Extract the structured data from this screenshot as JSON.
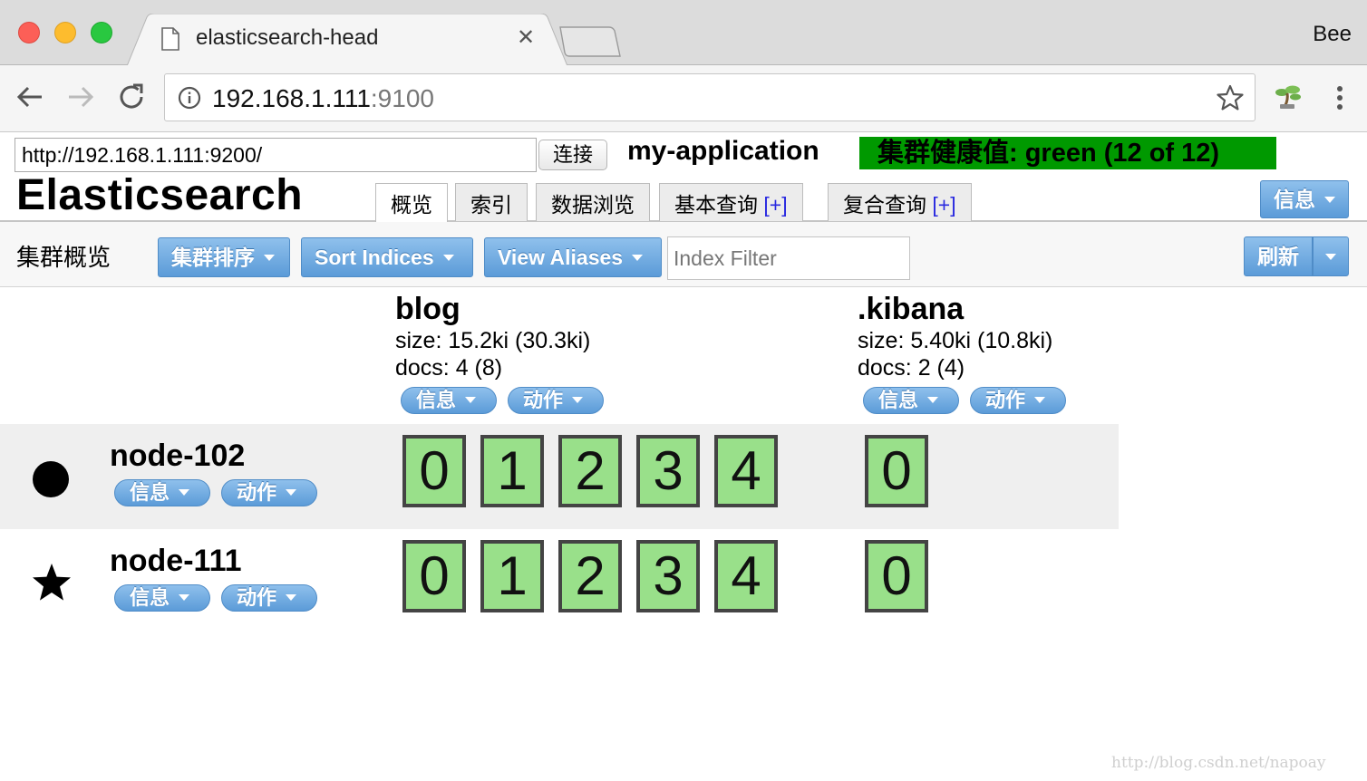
{
  "browser": {
    "tab_title": "elasticsearch-head",
    "profile_name": "Bee",
    "url_host": "192.168.1.111",
    "url_port": ":9100"
  },
  "header": {
    "connection_url": "http://192.168.1.111:9200/",
    "connect_label": "连接",
    "cluster_name": "my-application",
    "health_text": "集群健康值: green (12 of 12)",
    "health_color": "#009900",
    "brand": "Elasticsearch",
    "info_label": "信息",
    "tabs": [
      {
        "label": "概览",
        "plus": ""
      },
      {
        "label": "索引",
        "plus": ""
      },
      {
        "label": "数据浏览",
        "plus": ""
      },
      {
        "label": "基本查询 ",
        "plus": "[+]"
      },
      {
        "label": "复合查询 ",
        "plus": "[+]"
      }
    ]
  },
  "overview": {
    "title": "集群概览",
    "sort_cluster_label": "集群排序",
    "sort_indices_label": "Sort Indices",
    "view_aliases_label": "View Aliases",
    "index_filter_placeholder": "Index Filter",
    "refresh_label": "刷新"
  },
  "indices": [
    {
      "name": "blog",
      "size": "size: 15.2ki (30.3ki)",
      "docs": "docs: 4 (8)",
      "info_label": "信息",
      "action_label": "动作",
      "shards": [
        "0",
        "1",
        "2",
        "3",
        "4"
      ]
    },
    {
      "name": ".kibana",
      "size": "size: 5.40ki (10.8ki)",
      "docs": "docs: 2 (4)",
      "info_label": "信息",
      "action_label": "动作",
      "shards": [
        "0"
      ]
    }
  ],
  "nodes": [
    {
      "name": "node-102",
      "icon": "circle-icon",
      "info_label": "信息",
      "action_label": "动作"
    },
    {
      "name": "node-111",
      "icon": "star-icon",
      "info_label": "信息",
      "action_label": "动作"
    }
  ],
  "shard_color": "#99e08a",
  "watermark": "http://blog.csdn.net/napoay"
}
